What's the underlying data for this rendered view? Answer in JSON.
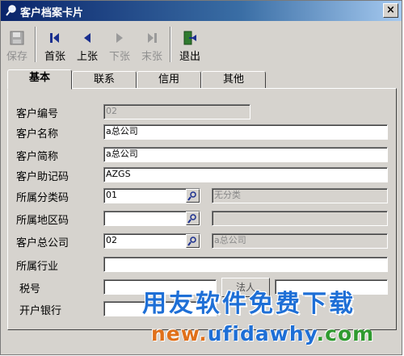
{
  "window": {
    "title": "客户档案卡片",
    "close_symbol": "×"
  },
  "toolbar": {
    "save": "保存",
    "first": "首张",
    "prev": "上张",
    "next": "下张",
    "last": "末张",
    "exit": "退出"
  },
  "tabs": [
    "基本",
    "联系",
    "信用",
    "其他"
  ],
  "form": {
    "customer_code": {
      "label": "客户编号",
      "value": "02"
    },
    "customer_name": {
      "label": "客户名称",
      "value": "a总公司"
    },
    "customer_short": {
      "label": "客户简称",
      "value": "a总公司"
    },
    "mnemonic": {
      "label": "客户助记码",
      "value": "AZGS"
    },
    "category": {
      "label": "所属分类码",
      "value": "01",
      "desc": "无分类"
    },
    "region": {
      "label": "所属地区码",
      "value": "",
      "desc": ""
    },
    "parent_company": {
      "label": "客户总公司",
      "value": "02",
      "desc": "a总公司"
    },
    "industry": {
      "label": "所属行业",
      "value": ""
    },
    "tax_no": {
      "label": "税号",
      "value": ""
    },
    "bank": {
      "label": "开户银行",
      "value": ""
    }
  },
  "hidden_button": {
    "label": "法人"
  },
  "watermark": {
    "line1": "用友软件免费下载",
    "line2": [
      {
        "text": "new.",
        "color": "#e0701a"
      },
      {
        "text": "ufidawhy",
        "color": "#1e6fd6"
      },
      {
        "text": ".com",
        "color": "#2f9a2f"
      }
    ]
  }
}
